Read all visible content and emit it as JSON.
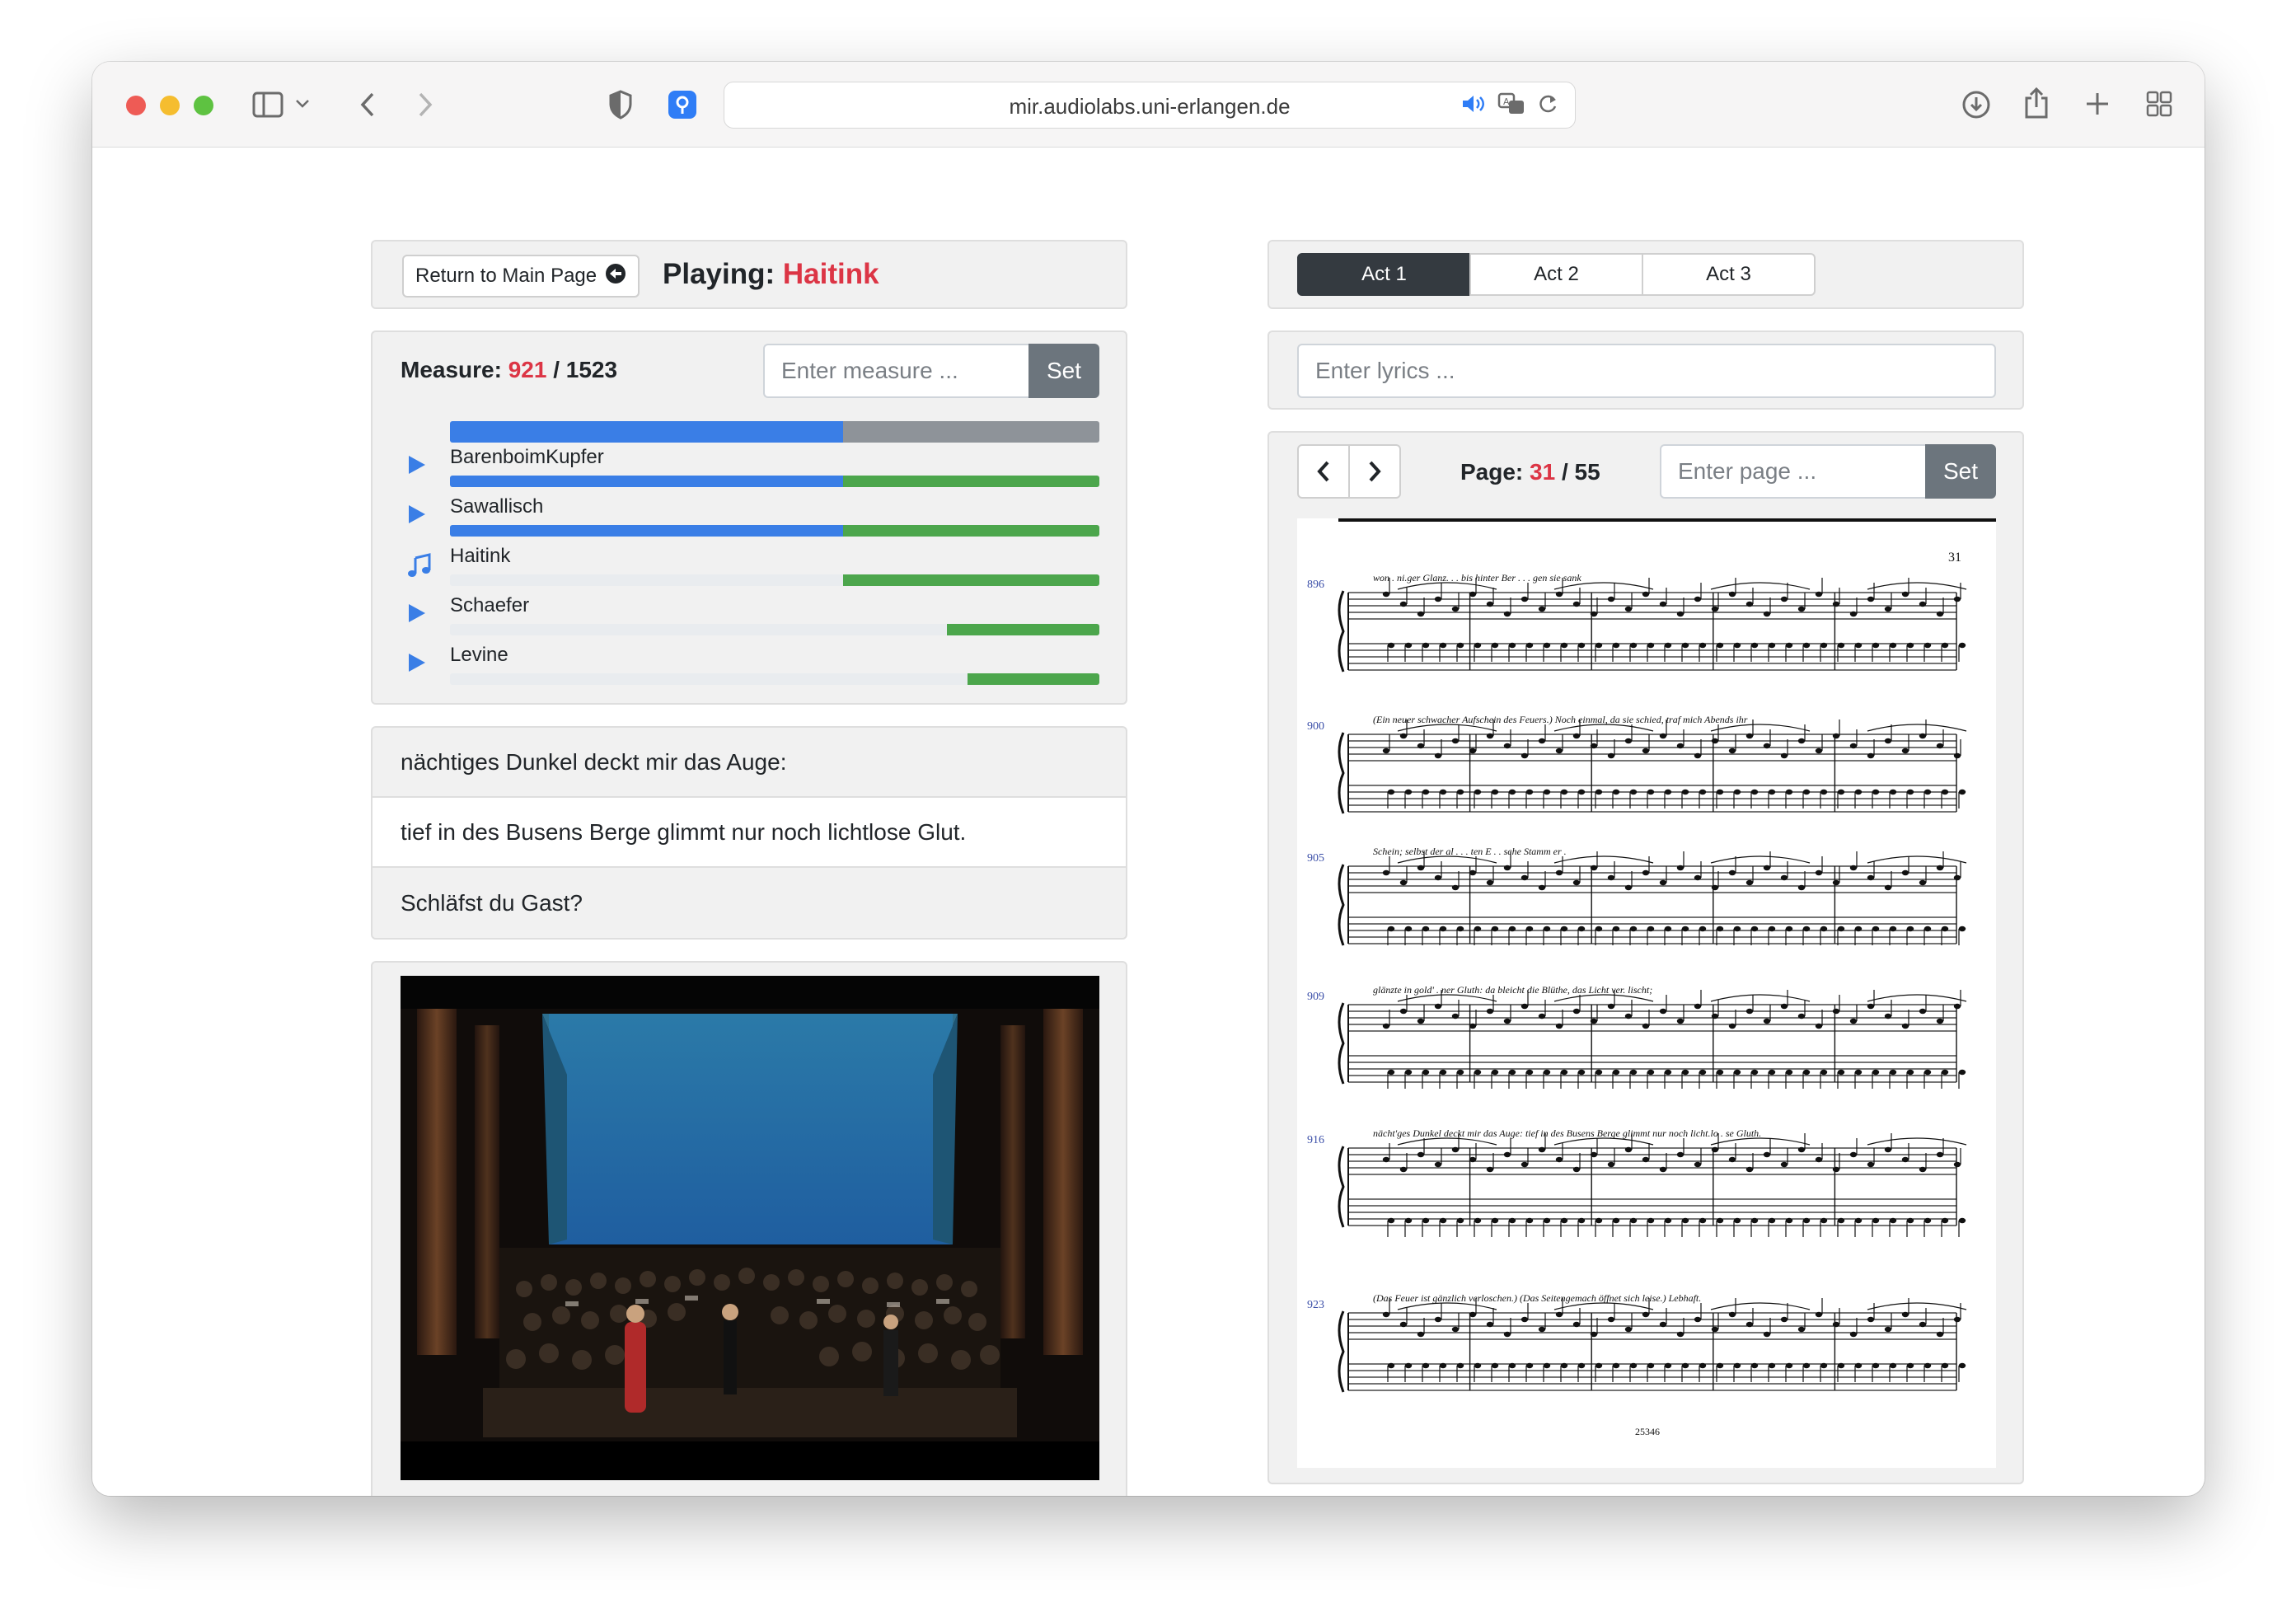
{
  "browser": {
    "url": "mir.audiolabs.uni-erlangen.de"
  },
  "player": {
    "return_label": "Return to Main Page",
    "playing_label": "Playing:",
    "playing_name": "Haitink"
  },
  "measure": {
    "label": "Measure:",
    "current": "921",
    "separator": "/",
    "total": "1523",
    "input_placeholder": "Enter measure ...",
    "set_label": "Set"
  },
  "recordings": [
    {
      "name": "BarenboimKupfer",
      "icon": "play-icon",
      "start": 0.0,
      "current": 0.605
    },
    {
      "name": "Sawallisch",
      "icon": "play-icon",
      "start": 0.0,
      "current": 0.605
    },
    {
      "name": "Haitink",
      "icon": "music-note-icon",
      "start": 0.605,
      "current": 0.605
    },
    {
      "name": "Schaefer",
      "icon": "play-icon",
      "start": 0.765,
      "current": 0.765
    },
    {
      "name": "Levine",
      "icon": "play-icon",
      "start": 0.797,
      "current": 0.797
    }
  ],
  "timeline_progress": 0.605,
  "colors": {
    "primary": "#3a7ee6",
    "success": "#4ca64c",
    "secondary": "#8e9399",
    "danger": "#dc3545"
  },
  "lyrics": [
    {
      "text": "nächtiges Dunkel deckt mir das Auge:",
      "active": false
    },
    {
      "text": "tief in des Busens Berge glimmt nur noch lichtlose Glut.",
      "active": true
    },
    {
      "text": "Schläfst du Gast?",
      "active": false
    }
  ],
  "acts": [
    {
      "label": "Act 1",
      "active": true
    },
    {
      "label": "Act 2",
      "active": false
    },
    {
      "label": "Act 3",
      "active": false
    }
  ],
  "lyrics_search": {
    "placeholder": "Enter lyrics ..."
  },
  "page": {
    "label": "Page:",
    "current": "31",
    "separator": "/",
    "total": "55",
    "input_placeholder": "Enter page ...",
    "set_label": "Set"
  },
  "score": {
    "page_number": "31",
    "plate_number": "25346",
    "systems": [
      {
        "measure": "896",
        "text": "won . ni.ger Glanz. . .    bis   hinter   Ber . . . gen sie   sank"
      },
      {
        "measure": "900",
        "text": "(Ein neuer schwacher Aufschein des Feuers.)   Noch einmal,  da  sie schied,    traf mich Abends ihr"
      },
      {
        "measure": "905",
        "text": "Schein;          selbst   der  al . . . ten   E . . sche   Stamm   er ."
      },
      {
        "measure": "909",
        "text": "glänzte  in  gold' . ner Gluth:          da  bleicht  die  Blüthe,  das Licht  ver. lischt;"
      },
      {
        "measure": "916",
        "text": "nächt'ges  Dunkel deckt mir das Auge:     tief in des Busens Berge glimmt nur noch licht.lo . se Gluth."
      },
      {
        "measure": "923",
        "text": "(Das Feuer ist gänzlich verloschen.)      (Das Seitengemach öffnet sich leise.)     Lebhaft."
      }
    ]
  }
}
